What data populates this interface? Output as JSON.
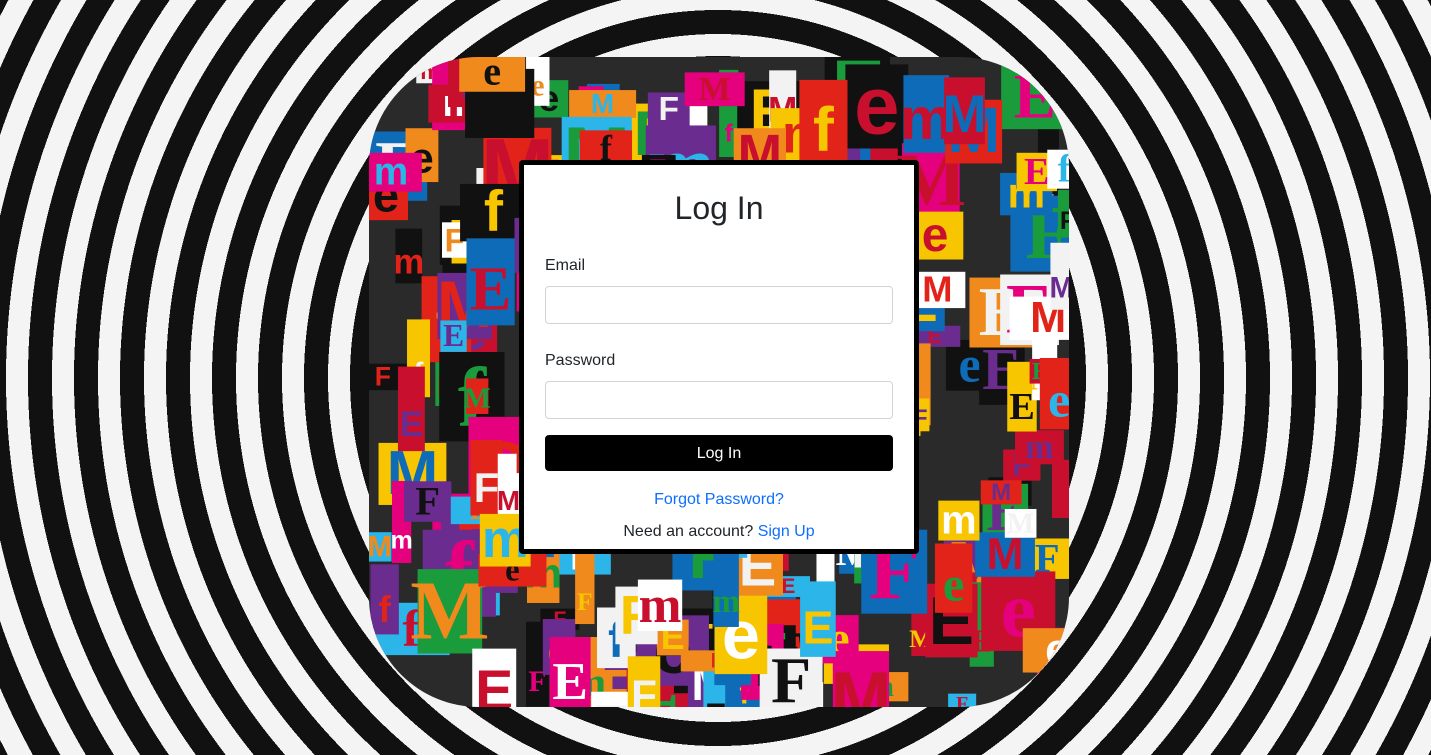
{
  "background": {
    "pattern": "concentric-rings",
    "colors": [
      "#f4f4f4",
      "#111111"
    ]
  },
  "collage": {
    "description_icon": "magazine-letter-collage-image",
    "letters": [
      "M",
      "E",
      "f",
      "e",
      "F",
      "m",
      "M",
      "E",
      "e",
      "F",
      "f",
      "M",
      "E",
      "m",
      "F",
      "e"
    ],
    "colors": [
      "#e2231a",
      "#f7c600",
      "#e5007e",
      "#0e6bb7",
      "#1a9b3c",
      "#111111",
      "#f2f2f2",
      "#f08a1d",
      "#6a2c8e",
      "#c8102e",
      "#2bb5e8",
      "#ffffff"
    ]
  },
  "login": {
    "title": "Log In",
    "email_label": "Email",
    "email_value": "",
    "password_label": "Password",
    "password_value": "",
    "submit_label": "Log In",
    "forgot_link": "Forgot Password?",
    "signup_prompt": "Need an account?",
    "signup_link": "Sign Up",
    "link_color": "#0d6efd",
    "button_color": "#000000"
  }
}
